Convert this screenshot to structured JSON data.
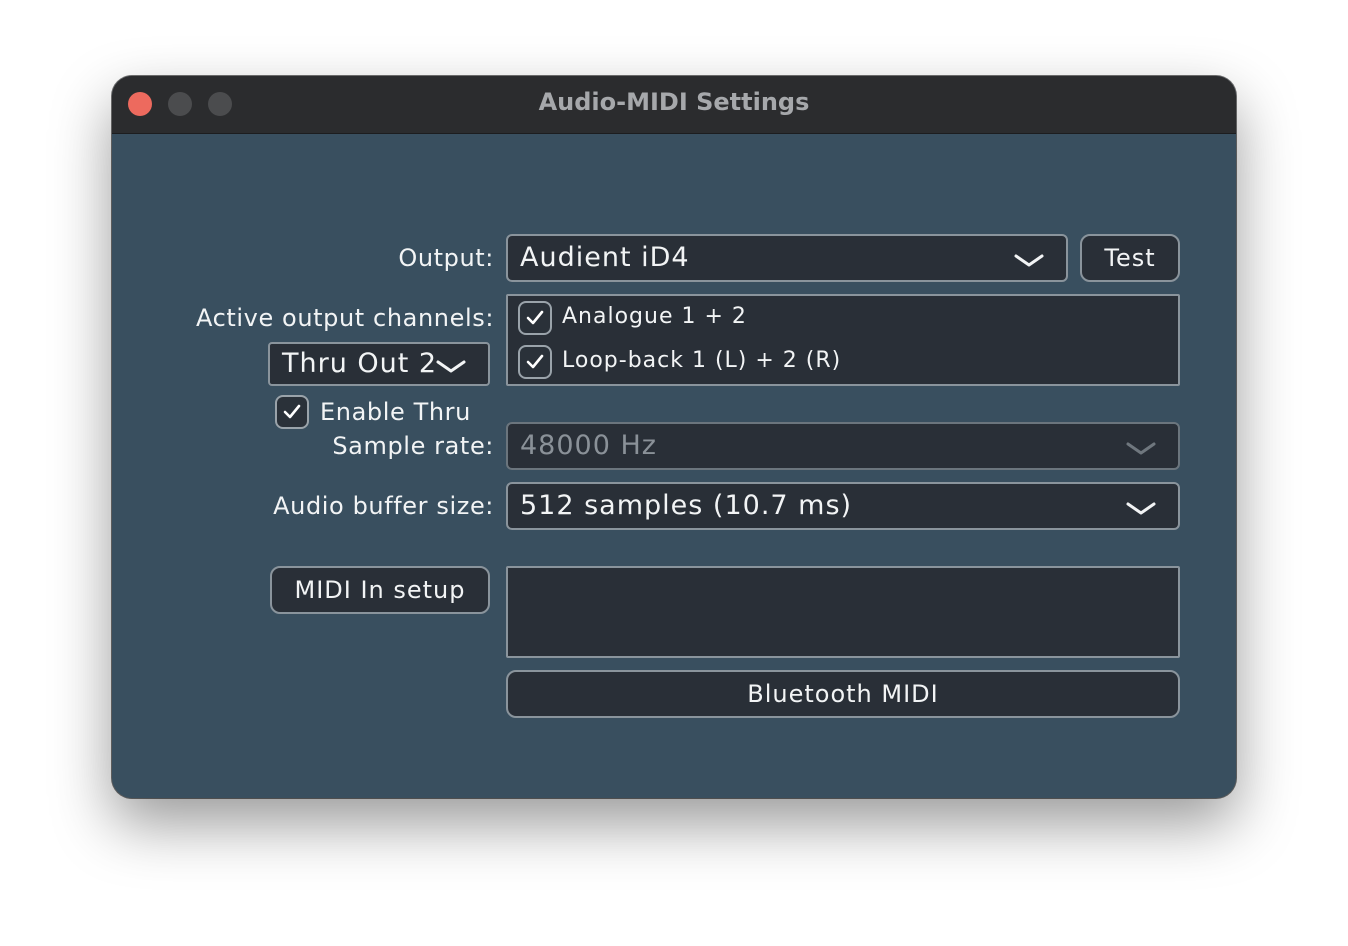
{
  "window": {
    "title": "Audio-MIDI Settings",
    "traffic_lights": [
      "close",
      "minimize",
      "maximize"
    ]
  },
  "output": {
    "label": "Output:",
    "selected": "Audient iD4",
    "test_button": "Test"
  },
  "active_channels": {
    "label": "Active output channels:",
    "channels": [
      {
        "name": "Analogue 1 + 2",
        "checked": true
      },
      {
        "name": "Loop-back 1 (L) + 2 (R)",
        "checked": true
      }
    ]
  },
  "thru": {
    "selected": "Thru Out 2",
    "enable_label": "Enable Thru",
    "enabled": true
  },
  "sample_rate": {
    "label": "Sample rate:",
    "selected": "48000 Hz",
    "disabled": true
  },
  "buffer": {
    "label": "Audio buffer size:",
    "selected": "512 samples (10.7 ms)"
  },
  "midi": {
    "setup_button": "MIDI In setup",
    "bluetooth_button": "Bluetooth MIDI"
  },
  "colors": {
    "panel_bg": "#394f5f",
    "control_bg": "#292f37",
    "close_light": "#ed6a5e",
    "text": "#f2f4f5",
    "disabled_text": "#8a9198"
  }
}
